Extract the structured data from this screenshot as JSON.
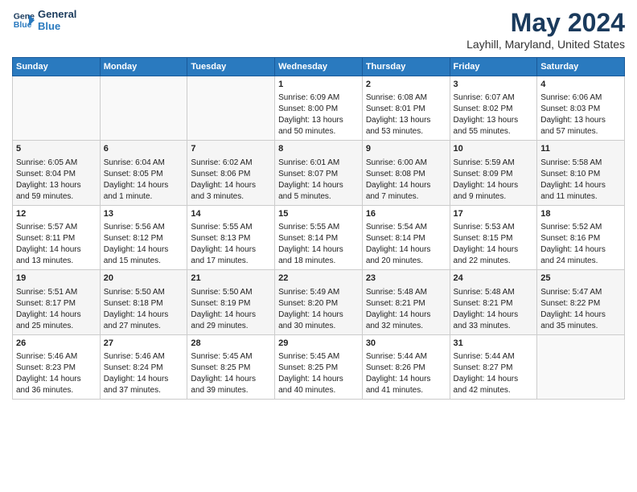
{
  "header": {
    "logo_line1": "General",
    "logo_line2": "Blue",
    "main_title": "May 2024",
    "subtitle": "Layhill, Maryland, United States"
  },
  "weekdays": [
    "Sunday",
    "Monday",
    "Tuesday",
    "Wednesday",
    "Thursday",
    "Friday",
    "Saturday"
  ],
  "weeks": [
    [
      {
        "day": "",
        "info": ""
      },
      {
        "day": "",
        "info": ""
      },
      {
        "day": "",
        "info": ""
      },
      {
        "day": "1",
        "info": "Sunrise: 6:09 AM\nSunset: 8:00 PM\nDaylight: 13 hours\nand 50 minutes."
      },
      {
        "day": "2",
        "info": "Sunrise: 6:08 AM\nSunset: 8:01 PM\nDaylight: 13 hours\nand 53 minutes."
      },
      {
        "day": "3",
        "info": "Sunrise: 6:07 AM\nSunset: 8:02 PM\nDaylight: 13 hours\nand 55 minutes."
      },
      {
        "day": "4",
        "info": "Sunrise: 6:06 AM\nSunset: 8:03 PM\nDaylight: 13 hours\nand 57 minutes."
      }
    ],
    [
      {
        "day": "5",
        "info": "Sunrise: 6:05 AM\nSunset: 8:04 PM\nDaylight: 13 hours\nand 59 minutes."
      },
      {
        "day": "6",
        "info": "Sunrise: 6:04 AM\nSunset: 8:05 PM\nDaylight: 14 hours\nand 1 minute."
      },
      {
        "day": "7",
        "info": "Sunrise: 6:02 AM\nSunset: 8:06 PM\nDaylight: 14 hours\nand 3 minutes."
      },
      {
        "day": "8",
        "info": "Sunrise: 6:01 AM\nSunset: 8:07 PM\nDaylight: 14 hours\nand 5 minutes."
      },
      {
        "day": "9",
        "info": "Sunrise: 6:00 AM\nSunset: 8:08 PM\nDaylight: 14 hours\nand 7 minutes."
      },
      {
        "day": "10",
        "info": "Sunrise: 5:59 AM\nSunset: 8:09 PM\nDaylight: 14 hours\nand 9 minutes."
      },
      {
        "day": "11",
        "info": "Sunrise: 5:58 AM\nSunset: 8:10 PM\nDaylight: 14 hours\nand 11 minutes."
      }
    ],
    [
      {
        "day": "12",
        "info": "Sunrise: 5:57 AM\nSunset: 8:11 PM\nDaylight: 14 hours\nand 13 minutes."
      },
      {
        "day": "13",
        "info": "Sunrise: 5:56 AM\nSunset: 8:12 PM\nDaylight: 14 hours\nand 15 minutes."
      },
      {
        "day": "14",
        "info": "Sunrise: 5:55 AM\nSunset: 8:13 PM\nDaylight: 14 hours\nand 17 minutes."
      },
      {
        "day": "15",
        "info": "Sunrise: 5:55 AM\nSunset: 8:14 PM\nDaylight: 14 hours\nand 18 minutes."
      },
      {
        "day": "16",
        "info": "Sunrise: 5:54 AM\nSunset: 8:14 PM\nDaylight: 14 hours\nand 20 minutes."
      },
      {
        "day": "17",
        "info": "Sunrise: 5:53 AM\nSunset: 8:15 PM\nDaylight: 14 hours\nand 22 minutes."
      },
      {
        "day": "18",
        "info": "Sunrise: 5:52 AM\nSunset: 8:16 PM\nDaylight: 14 hours\nand 24 minutes."
      }
    ],
    [
      {
        "day": "19",
        "info": "Sunrise: 5:51 AM\nSunset: 8:17 PM\nDaylight: 14 hours\nand 25 minutes."
      },
      {
        "day": "20",
        "info": "Sunrise: 5:50 AM\nSunset: 8:18 PM\nDaylight: 14 hours\nand 27 minutes."
      },
      {
        "day": "21",
        "info": "Sunrise: 5:50 AM\nSunset: 8:19 PM\nDaylight: 14 hours\nand 29 minutes."
      },
      {
        "day": "22",
        "info": "Sunrise: 5:49 AM\nSunset: 8:20 PM\nDaylight: 14 hours\nand 30 minutes."
      },
      {
        "day": "23",
        "info": "Sunrise: 5:48 AM\nSunset: 8:21 PM\nDaylight: 14 hours\nand 32 minutes."
      },
      {
        "day": "24",
        "info": "Sunrise: 5:48 AM\nSunset: 8:21 PM\nDaylight: 14 hours\nand 33 minutes."
      },
      {
        "day": "25",
        "info": "Sunrise: 5:47 AM\nSunset: 8:22 PM\nDaylight: 14 hours\nand 35 minutes."
      }
    ],
    [
      {
        "day": "26",
        "info": "Sunrise: 5:46 AM\nSunset: 8:23 PM\nDaylight: 14 hours\nand 36 minutes."
      },
      {
        "day": "27",
        "info": "Sunrise: 5:46 AM\nSunset: 8:24 PM\nDaylight: 14 hours\nand 37 minutes."
      },
      {
        "day": "28",
        "info": "Sunrise: 5:45 AM\nSunset: 8:25 PM\nDaylight: 14 hours\nand 39 minutes."
      },
      {
        "day": "29",
        "info": "Sunrise: 5:45 AM\nSunset: 8:25 PM\nDaylight: 14 hours\nand 40 minutes."
      },
      {
        "day": "30",
        "info": "Sunrise: 5:44 AM\nSunset: 8:26 PM\nDaylight: 14 hours\nand 41 minutes."
      },
      {
        "day": "31",
        "info": "Sunrise: 5:44 AM\nSunset: 8:27 PM\nDaylight: 14 hours\nand 42 minutes."
      },
      {
        "day": "",
        "info": ""
      }
    ]
  ]
}
